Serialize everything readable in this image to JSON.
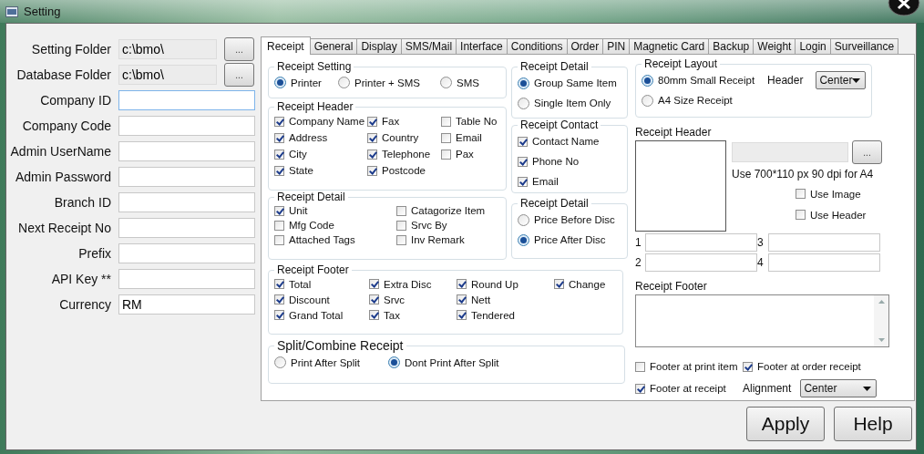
{
  "window": {
    "title": "Setting"
  },
  "fields": [
    {
      "label": "Setting Folder",
      "value": "c:\\bmo\\",
      "readonly": true,
      "focused": false,
      "browse": "..."
    },
    {
      "label": "Database Folder",
      "value": "c:\\bmo\\",
      "readonly": true,
      "focused": false,
      "browse": "..."
    },
    {
      "label": "Company ID",
      "readonly": false,
      "focused": true
    },
    {
      "label": "Company Code",
      "readonly": false,
      "focused": false
    },
    {
      "label": "Admin UserName",
      "readonly": false,
      "focused": false
    },
    {
      "label": "Admin Password",
      "readonly": false,
      "focused": false
    },
    {
      "label": "Branch ID",
      "readonly": false,
      "focused": false
    },
    {
      "label": "Next Receipt No",
      "readonly": false,
      "focused": false
    },
    {
      "label": "Prefix",
      "readonly": false,
      "focused": false
    },
    {
      "label": "API Key **",
      "readonly": false,
      "focused": false
    },
    {
      "label": "Currency",
      "value": "RM",
      "readonly": false,
      "focused": false
    }
  ],
  "tabs": [
    {
      "label": "Receipt",
      "selected": true
    },
    {
      "label": "General",
      "selected": false
    },
    {
      "label": "Display",
      "selected": false
    },
    {
      "label": "SMS/Mail",
      "selected": false
    },
    {
      "label": "Interface",
      "selected": false
    },
    {
      "label": "Conditions",
      "selected": false
    },
    {
      "label": "Order",
      "selected": false
    },
    {
      "label": "PIN",
      "selected": false
    },
    {
      "label": "Magnetic Card",
      "selected": false
    },
    {
      "label": "Backup",
      "selected": false
    },
    {
      "label": "Weight",
      "selected": false
    },
    {
      "label": "Login",
      "selected": false
    },
    {
      "label": "Surveillance",
      "selected": false
    }
  ],
  "left_groups": [
    {
      "title": "Receipt Setting",
      "kind": "radio",
      "columns": [
        [
          {
            "label": "Printer",
            "selected": true
          }
        ],
        [
          {
            "label": "Printer + SMS",
            "selected": false
          }
        ],
        [
          {
            "label": "SMS",
            "selected": false
          }
        ]
      ]
    },
    {
      "title": "Receipt Header",
      "kind": "check",
      "columns": [
        [
          {
            "label": "Company Name",
            "checked": true
          },
          {
            "label": "Address",
            "checked": true
          },
          {
            "label": "City",
            "checked": true
          },
          {
            "label": "State",
            "checked": true
          }
        ],
        [
          {
            "label": "Fax",
            "checked": true
          },
          {
            "label": "Country",
            "checked": true
          },
          {
            "label": "Telephone",
            "checked": true
          },
          {
            "label": "Postcode",
            "checked": true
          }
        ],
        [
          {
            "label": "Table No",
            "checked": false
          },
          {
            "label": "Email",
            "checked": false
          },
          {
            "label": "Pax",
            "checked": false
          }
        ]
      ]
    },
    {
      "title": "Receipt Detail",
      "kind": "check",
      "columns": [
        [
          {
            "label": "Unit",
            "checked": true
          },
          {
            "label": "Mfg Code",
            "checked": false
          },
          {
            "label": "Attached Tags",
            "checked": false
          }
        ],
        [
          {
            "label": "Catagorize Item",
            "checked": false
          },
          {
            "label": "Srvc By",
            "checked": false
          },
          {
            "label": "Inv Remark",
            "checked": false
          }
        ]
      ]
    }
  ],
  "middle_groups": [
    {
      "title": "Receipt Detail",
      "kind": "radio",
      "columns": [
        [
          {
            "label": "Group Same Item",
            "selected": true
          },
          {
            "label": "Single Item Only",
            "selected": false
          }
        ]
      ]
    },
    {
      "title": "Receipt Contact",
      "kind": "check",
      "columns": [
        [
          {
            "label": "Contact Name",
            "checked": true
          },
          {
            "label": "Phone No",
            "checked": true
          },
          {
            "label": "Email",
            "checked": true
          }
        ]
      ]
    },
    {
      "title": "Receipt Detail",
      "kind": "radio",
      "columns": [
        [
          {
            "label": "Price Before Disc",
            "selected": false
          },
          {
            "label": "Price After Disc",
            "selected": true
          }
        ]
      ]
    }
  ],
  "receipt_footer": {
    "title": "Receipt Footer",
    "columns": [
      [
        {
          "label": "Total",
          "checked": true
        },
        {
          "label": "Discount",
          "checked": true
        },
        {
          "label": "Grand Total",
          "checked": true
        }
      ],
      [
        {
          "label": "Extra Disc",
          "checked": true
        },
        {
          "label": "Srvc",
          "checked": true
        },
        {
          "label": "Tax",
          "checked": true
        }
      ],
      [
        {
          "label": "Round Up",
          "checked": true
        },
        {
          "label": "Nett",
          "checked": true
        },
        {
          "label": "Tendered",
          "checked": true
        }
      ],
      [
        {
          "label": "Change",
          "checked": true
        }
      ]
    ]
  },
  "split_receipt": {
    "title": "Split/Combine Receipt",
    "columns": [
      [
        {
          "label": "Print After Split",
          "selected": false
        }
      ],
      [
        {
          "label": "Dont Print After Split",
          "selected": true
        }
      ]
    ]
  },
  "receipt_layout": {
    "title": "Receipt Layout",
    "options": [
      {
        "label": "80mm Small Receipt",
        "selected": true
      },
      {
        "label": "A4 Size Receipt",
        "selected": false
      }
    ],
    "header_label": "Header",
    "header_value": "Center"
  },
  "header_image": {
    "label": "Receipt Header",
    "browse": "...",
    "hint": "Use 700*110 px 90 dpi for A4",
    "checks": [
      {
        "label": "Use Image",
        "checked": false
      },
      {
        "label": "Use Header",
        "checked": false
      }
    ],
    "lines": [
      {
        "label": "1"
      },
      {
        "label": "3"
      },
      {
        "label": "2"
      },
      {
        "label": "4"
      }
    ]
  },
  "footer_text": {
    "label": "Receipt Footer",
    "checks": [
      {
        "label": "Footer at print item",
        "checked": false
      },
      {
        "label": "Footer at order receipt",
        "checked": true
      },
      {
        "label": "Footer at receipt",
        "checked": true
      }
    ],
    "alignment_label": "Alignment",
    "alignment_value": "Center"
  },
  "buttons": [
    "Apply",
    "Help"
  ]
}
